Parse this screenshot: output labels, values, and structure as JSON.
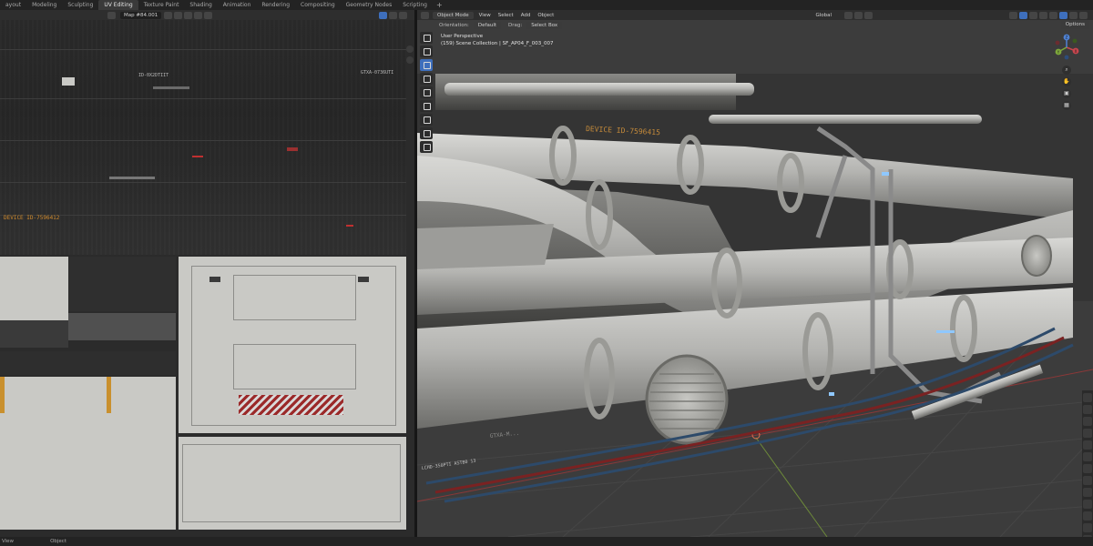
{
  "workspaces": {
    "tabs": [
      "ayout",
      "Modeling",
      "Sculpting",
      "UV Editing",
      "Texture Paint",
      "Shading",
      "Animation",
      "Rendering",
      "Compositing",
      "Geometry Nodes",
      "Scripting"
    ],
    "active": "UV Editing",
    "add_icon": "plus-icon"
  },
  "uv_editor": {
    "image_name": "Map #84.001",
    "texture_labels": {
      "id_top": "ID-0X2DTIIT",
      "gtxa": "GTXA-0736UTI",
      "device": "DEVICE ID-7596412"
    }
  },
  "viewport": {
    "mode": "Object Mode",
    "menus": [
      "View",
      "Select",
      "Add",
      "Object"
    ],
    "orientation_label": "Orientation:",
    "orientation_value": "Default",
    "drag_label": "Drag:",
    "drag_value": "Select Box",
    "transform_orientation": "Global",
    "options_label": "Options",
    "perspective": "User Perspective",
    "collection_info": "(159) Scene Collection | SF_AP04_F_003_007",
    "pipe_labels": {
      "device": "DEVICE ID-7596415",
      "gtxa": "GTXA-M...",
      "lchd": "LCHD-350PTI ASTB0 13"
    },
    "gizmo_axes": {
      "x": "X",
      "y": "Y",
      "z": "Z"
    },
    "colors": {
      "x_axis": "#c8464e",
      "y_axis": "#7ea83b",
      "z_axis": "#4f82d4",
      "accent": "#3e6fbd"
    }
  },
  "status_bar": {
    "left": "View",
    "right": "Object"
  }
}
